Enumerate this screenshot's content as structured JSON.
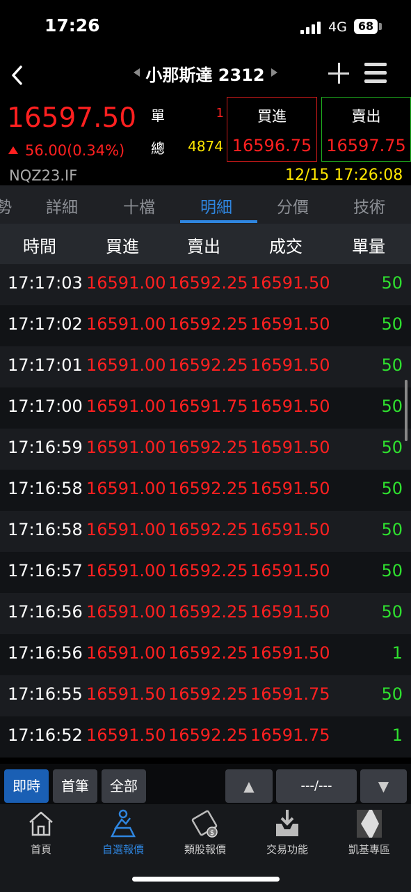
{
  "status_bar": {
    "time": "17:26",
    "network": "4G",
    "battery": "68"
  },
  "nav": {
    "title": "小那斯達 2312"
  },
  "quote": {
    "price": "16597.50",
    "change": "56.00(0.34%)",
    "symbol": "NQZ23.IF",
    "single_label": "單",
    "single_value": "1",
    "total_label": "總",
    "total_value": "4874",
    "buy_label": "買進",
    "buy_price": "16596.75",
    "sell_label": "賣出",
    "sell_price": "16597.75",
    "datetime": "12/15 17:26:08"
  },
  "tabs": [
    "勢",
    "詳細",
    "十檔",
    "明細",
    "分價",
    "技術"
  ],
  "active_tab": "明細",
  "table": {
    "headers": [
      "時間",
      "買進",
      "賣出",
      "成交",
      "單量"
    ],
    "rows": [
      [
        "17:17:03",
        "16591.00",
        "16592.25",
        "16591.50",
        "50"
      ],
      [
        "17:17:02",
        "16591.00",
        "16592.25",
        "16591.50",
        "50"
      ],
      [
        "17:17:01",
        "16591.00",
        "16592.25",
        "16591.50",
        "50"
      ],
      [
        "17:17:00",
        "16591.00",
        "16591.75",
        "16591.50",
        "50"
      ],
      [
        "17:16:59",
        "16591.00",
        "16592.25",
        "16591.50",
        "50"
      ],
      [
        "17:16:58",
        "16591.00",
        "16592.25",
        "16591.50",
        "50"
      ],
      [
        "17:16:58",
        "16591.00",
        "16592.25",
        "16591.50",
        "50"
      ],
      [
        "17:16:57",
        "16591.00",
        "16592.25",
        "16591.50",
        "50"
      ],
      [
        "17:16:56",
        "16591.00",
        "16592.25",
        "16591.50",
        "50"
      ],
      [
        "17:16:56",
        "16591.00",
        "16592.25",
        "16591.50",
        "1"
      ],
      [
        "17:16:55",
        "16591.50",
        "16592.25",
        "16591.75",
        "50"
      ],
      [
        "17:16:52",
        "16591.50",
        "16592.25",
        "16591.75",
        "1"
      ]
    ]
  },
  "controls": {
    "realtime": "即時",
    "first": "首筆",
    "all": "全部",
    "up": "▲",
    "page": "---/---",
    "down": "▼"
  },
  "bottom_nav": [
    {
      "label": "首頁",
      "icon": "home-icon"
    },
    {
      "label": "自選報價",
      "icon": "watchlist-icon"
    },
    {
      "label": "類股報價",
      "icon": "sector-quote-icon"
    },
    {
      "label": "交易功能",
      "icon": "trade-icon"
    },
    {
      "label": "凱基專區",
      "icon": "kgi-logo-icon"
    }
  ],
  "colors": {
    "up": "#ff2020",
    "volume": "#2fe02f",
    "accent": "#2f86e0",
    "highlight": "#ffe600"
  }
}
